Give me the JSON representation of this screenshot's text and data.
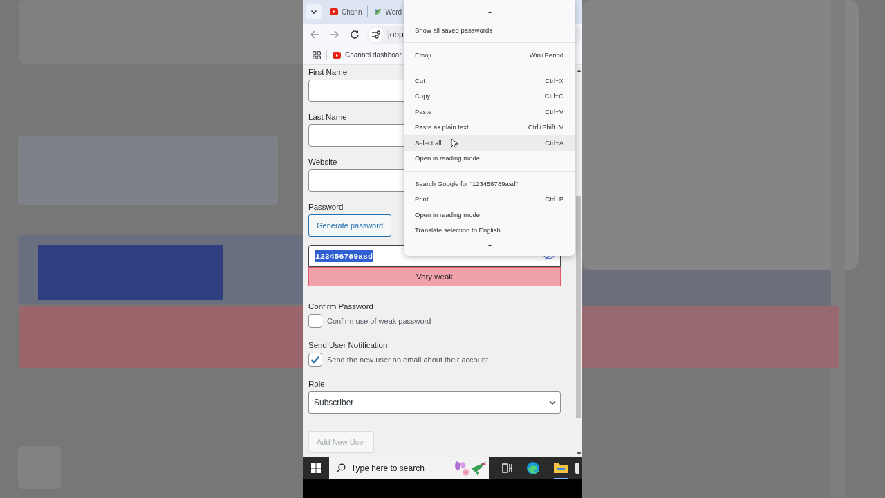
{
  "browser": {
    "tabs": [
      {
        "kind": "youtube",
        "title": "Chann"
      },
      {
        "kind": "wordpress",
        "title": "Word"
      }
    ],
    "address": "jobp",
    "bookmarks": [
      {
        "kind": "youtube",
        "title": "Channel dashboar"
      }
    ]
  },
  "form": {
    "fields": [
      {
        "kind": "text",
        "label": "First Name"
      },
      {
        "kind": "text",
        "label": "Last Name"
      },
      {
        "kind": "text",
        "label": "Website"
      },
      {
        "kind": "password",
        "label": "Password",
        "button": "Generate password",
        "value": "123456789asd",
        "value_selected": true,
        "strength": "Very weak"
      },
      {
        "kind": "checkbox",
        "label": "Confirm Password",
        "text": "Confirm use of weak password",
        "checked": false
      },
      {
        "kind": "checkbox",
        "label": "Send User Notification",
        "text": "Send the new user an email about their account",
        "checked": true
      },
      {
        "kind": "select",
        "label": "Role",
        "value": "Subscriber"
      }
    ],
    "submit": {
      "label": "Add New User",
      "disabled": true
    }
  },
  "context_menu": {
    "items": [
      {
        "kind": "scroll-up"
      },
      {
        "kind": "item",
        "label": "Show all saved passwords",
        "selected": false
      },
      {
        "kind": "separator"
      },
      {
        "kind": "item",
        "label": "Emoji",
        "shortcut": "Win+Period",
        "selected": false
      },
      {
        "kind": "separator"
      },
      {
        "kind": "item",
        "label": "Cut",
        "shortcut": "Ctrl+X",
        "selected": false
      },
      {
        "kind": "item",
        "label": "Copy",
        "shortcut": "Ctrl+C",
        "selected": false
      },
      {
        "kind": "item",
        "label": "Paste",
        "shortcut": "Ctrl+V",
        "selected": false
      },
      {
        "kind": "item",
        "label": "Paste as plain text",
        "shortcut": "Ctrl+Shift+V",
        "selected": false
      },
      {
        "kind": "item",
        "label": "Select all",
        "shortcut": "Ctrl+A",
        "selected": true
      },
      {
        "kind": "item",
        "label": "Open in reading mode",
        "selected": false
      },
      {
        "kind": "separator"
      },
      {
        "kind": "item",
        "label": "Search Google for “123456789asd”",
        "selected": false
      },
      {
        "kind": "item",
        "label": "Print...",
        "shortcut": "Ctrl+P",
        "selected": false
      },
      {
        "kind": "item",
        "label": "Open in reading mode",
        "selected": false
      },
      {
        "kind": "item",
        "label": "Translate selection to English",
        "selected": false
      },
      {
        "kind": "scroll-down"
      }
    ]
  },
  "taskbar": {
    "search": {
      "placeholder": "Type here to search"
    }
  }
}
